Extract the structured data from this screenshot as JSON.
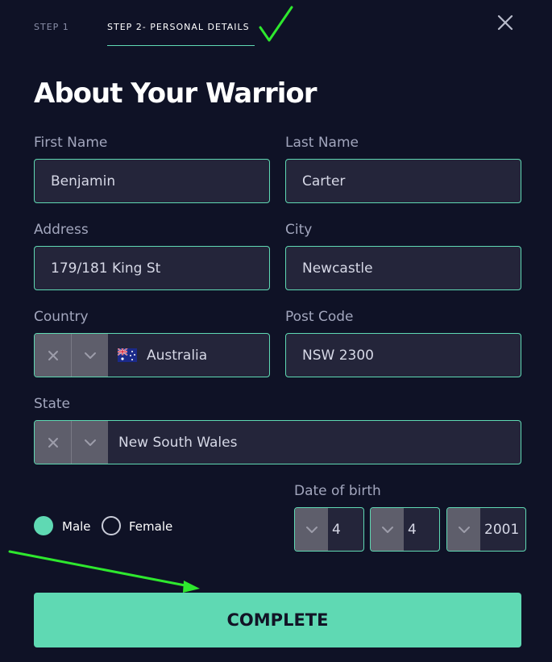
{
  "stepper": {
    "step1_label": "STEP 1",
    "step2_label": "STEP 2- PERSONAL DETAILS",
    "active_color": "#5fd9b3"
  },
  "page_title": "About Your Warrior",
  "form": {
    "first_name": {
      "label": "First Name",
      "value": "Benjamin"
    },
    "last_name": {
      "label": "Last Name",
      "value": "Carter"
    },
    "address": {
      "label": "Address",
      "value": "179/181 King St"
    },
    "city": {
      "label": "City",
      "value": "Newcastle"
    },
    "country": {
      "label": "Country",
      "value": "Australia",
      "flag_icon": "australia-flag-icon"
    },
    "post_code": {
      "label": "Post Code",
      "value": "NSW 2300"
    },
    "state": {
      "label": "State",
      "value": "New South Wales"
    },
    "gender": {
      "options": [
        {
          "label": "Male",
          "selected": true
        },
        {
          "label": "Female",
          "selected": false
        }
      ]
    },
    "date_of_birth": {
      "label": "Date of birth",
      "day": "4",
      "month": "4",
      "year": "2001"
    }
  },
  "complete_button": {
    "label": "COMPLETE"
  },
  "icons": {
    "close": "close-icon",
    "clear": "clear-x-icon",
    "chevron": "chevron-down-icon",
    "check": "checkmark-annotation-icon"
  },
  "colors": {
    "background": "#0f1226",
    "accent": "#5fd9b3",
    "input_bg": "#24253a",
    "annotation": "#2ee82e"
  }
}
